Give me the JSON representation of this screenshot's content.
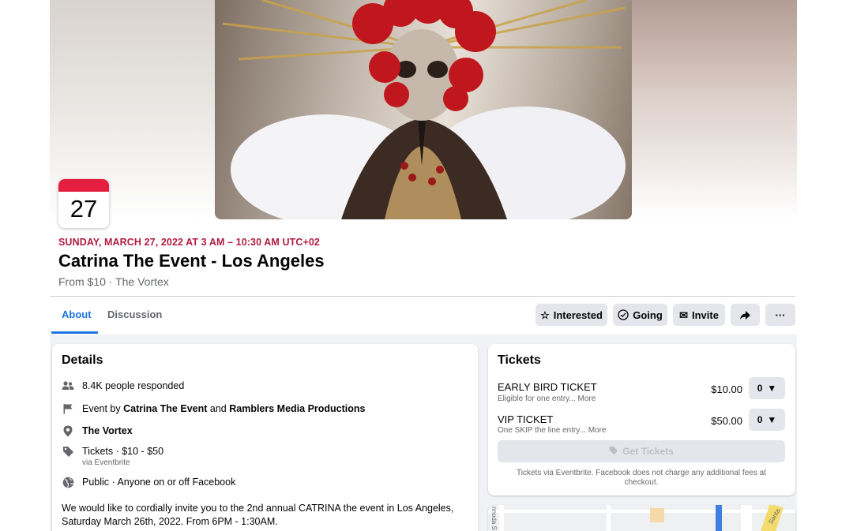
{
  "event": {
    "day": "27",
    "date_line": "SUNDAY, MARCH 27, 2022 AT 3 AM – 10:30 AM UTC+02",
    "title": "Catrina The Event - Los Angeles",
    "subtitle": "From $10 · The Vortex"
  },
  "tabs": [
    {
      "label": "About",
      "active": true
    },
    {
      "label": "Discussion",
      "active": false
    }
  ],
  "actions": {
    "interested": "Interested",
    "going": "Going",
    "invite": "Invite",
    "share_icon": "share-icon",
    "more_label": "···"
  },
  "details": {
    "heading": "Details",
    "responded": "8.4K people responded",
    "event_by_prefix": "Event by",
    "host_1": "Catrina The Event",
    "and": "and",
    "host_2": "Ramblers Media Productions",
    "location": "The Vortex",
    "tickets_line": "Tickets · $10 - $50",
    "tickets_via": "via Eventbrite",
    "privacy": "Public · Anyone on or off Facebook",
    "description": "We would like to cordially invite you to the 2nd annual CATRINA the event in Los Angeles, Saturday March 26th, 2022. From 6PM - 1:30AM."
  },
  "tickets": {
    "heading": "Tickets",
    "items": [
      {
        "name": "EARLY BIRD TICKET",
        "note": "Eligible for one entry... More",
        "price": "$10.00",
        "qty": "0"
      },
      {
        "name": "VIP TICKET",
        "note": "One SKIP the line entry... More",
        "price": "$50.00",
        "qty": "0"
      }
    ],
    "get_tickets": "Get Tickets",
    "footer": "Tickets via Eventbrite. Facebook does not charge any additional fees at checkout."
  },
  "map": {
    "street_label": "nnoda S",
    "street_label_2": "Santa"
  },
  "colors": {
    "accent": "#1b74e4",
    "date_red": "#b31c41",
    "badge_red": "#e41e3f",
    "button_gray": "#e4e6eb",
    "page_gray": "#f0f2f5"
  }
}
